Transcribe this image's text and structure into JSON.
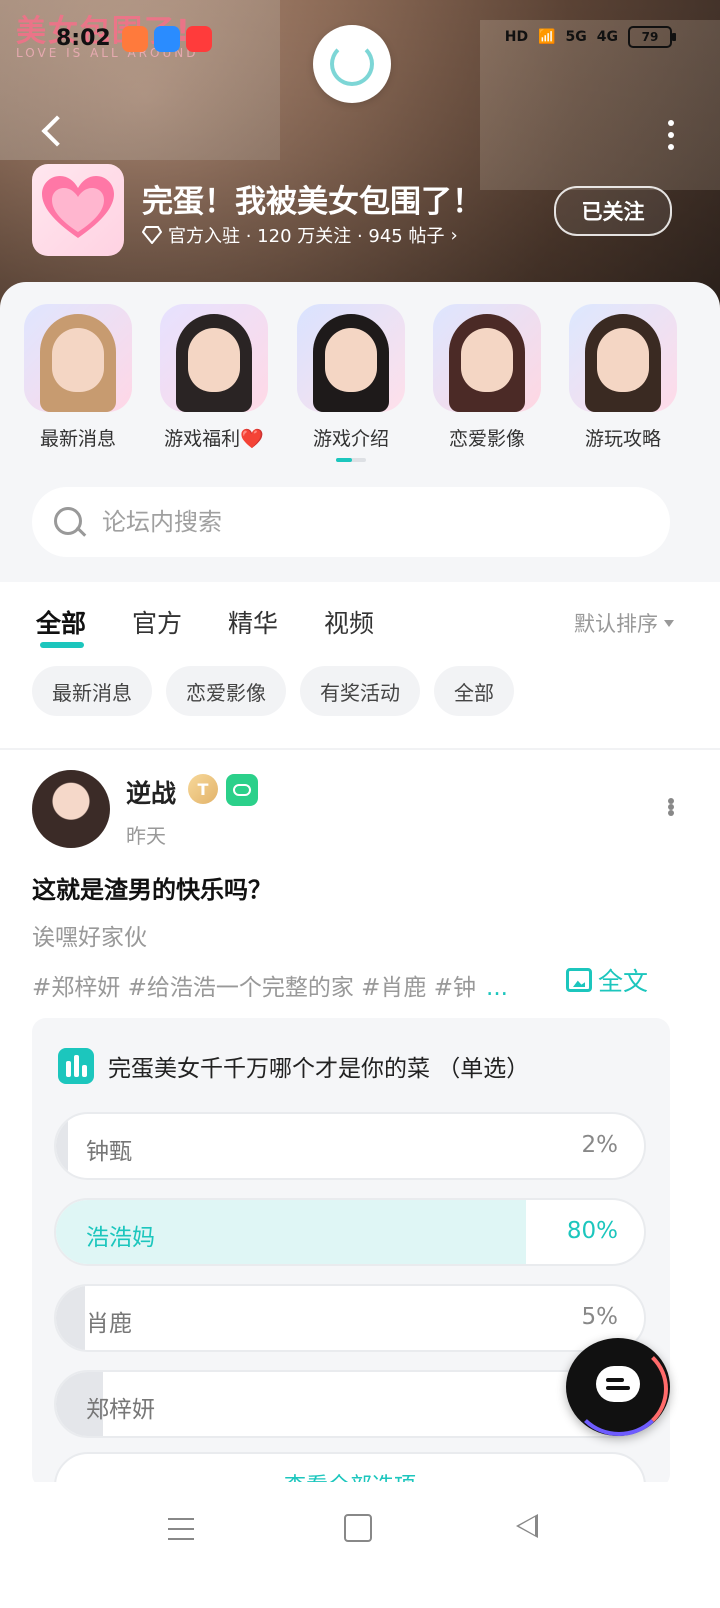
{
  "status_bar": {
    "time": "8:02",
    "network_labels": [
      "HD",
      "5G",
      "4G"
    ],
    "battery": "79"
  },
  "hero": {
    "watermark_title": "美女包围了!",
    "watermark_sub": "LOVE IS ALL AROUND"
  },
  "forum": {
    "title": "完蛋！我被美女包围了！",
    "meta": "官方入驻 · 120 万关注 · 945 帖子",
    "follow_label": "已关注"
  },
  "quick_links": [
    {
      "label": "最新消息",
      "hair": "#c79b70"
    },
    {
      "label": "游戏福利❤️",
      "hair": "#2a2424"
    },
    {
      "label": "游戏介绍",
      "hair": "#1e1a1a"
    },
    {
      "label": "恋爱影像",
      "hair": "#4b2a26"
    },
    {
      "label": "游玩攻略",
      "hair": "#3a2a22"
    }
  ],
  "search": {
    "placeholder": "论坛内搜索"
  },
  "tabs": [
    "全部",
    "官方",
    "精华",
    "视频"
  ],
  "sort_label": "默认排序",
  "chips": [
    "最新消息",
    "恋爱影像",
    "有奖活动",
    "全部"
  ],
  "post": {
    "username": "逆战",
    "level_badge": "T",
    "time": "昨天",
    "title": "这就是渣男的快乐吗？",
    "body": "诶嘿好家伙",
    "tags": "#郑梓妍 #给浩浩一个完整的家 #肖鹿 #钟",
    "tags_more": "...",
    "fulltext_label": "全文",
    "poll": {
      "question": "完蛋美女千千万哪个才是你的菜 （单选）",
      "options": [
        {
          "name": "钟甄",
          "pct_label": "2%",
          "value": 0.02,
          "winner": false
        },
        {
          "name": "浩浩妈",
          "pct_label": "80%",
          "value": 0.8,
          "winner": true
        },
        {
          "name": "肖鹿",
          "pct_label": "5%",
          "value": 0.05,
          "winner": false
        },
        {
          "name": "郑梓妍",
          "pct_label": "",
          "value": 0.08,
          "winner": false
        }
      ],
      "view_all_label": "查看全部选项"
    }
  },
  "colors": {
    "accent": "#1cc6bd",
    "accent_light": "#dff6f5"
  }
}
